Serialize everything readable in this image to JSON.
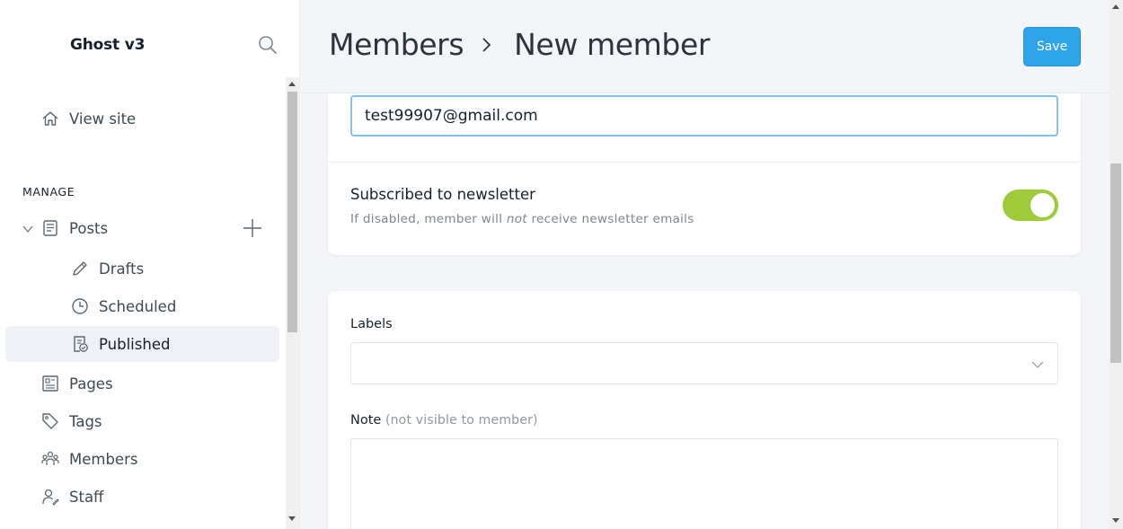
{
  "sidebar": {
    "brand": "Ghost v3",
    "view_site": "View site",
    "section": "MANAGE",
    "posts": "Posts",
    "drafts": "Drafts",
    "scheduled": "Scheduled",
    "published": "Published",
    "pages": "Pages",
    "tags": "Tags",
    "members": "Members",
    "staff": "Staff"
  },
  "header": {
    "crumb_parent": "Members",
    "crumb_current": "New member",
    "save_label": "Save"
  },
  "form": {
    "email_value": "test99907@gmail.com",
    "newsletter_title": "Subscribed to newsletter",
    "newsletter_desc_pre": "If disabled, member will ",
    "newsletter_desc_em": "not",
    "newsletter_desc_post": " receive newsletter emails",
    "newsletter_enabled": true,
    "labels_label": "Labels",
    "note_label": "Note",
    "note_hint": "(not visible to member)"
  },
  "colors": {
    "accent": "#2da3e9",
    "toggle_on": "#9fcb3b"
  }
}
